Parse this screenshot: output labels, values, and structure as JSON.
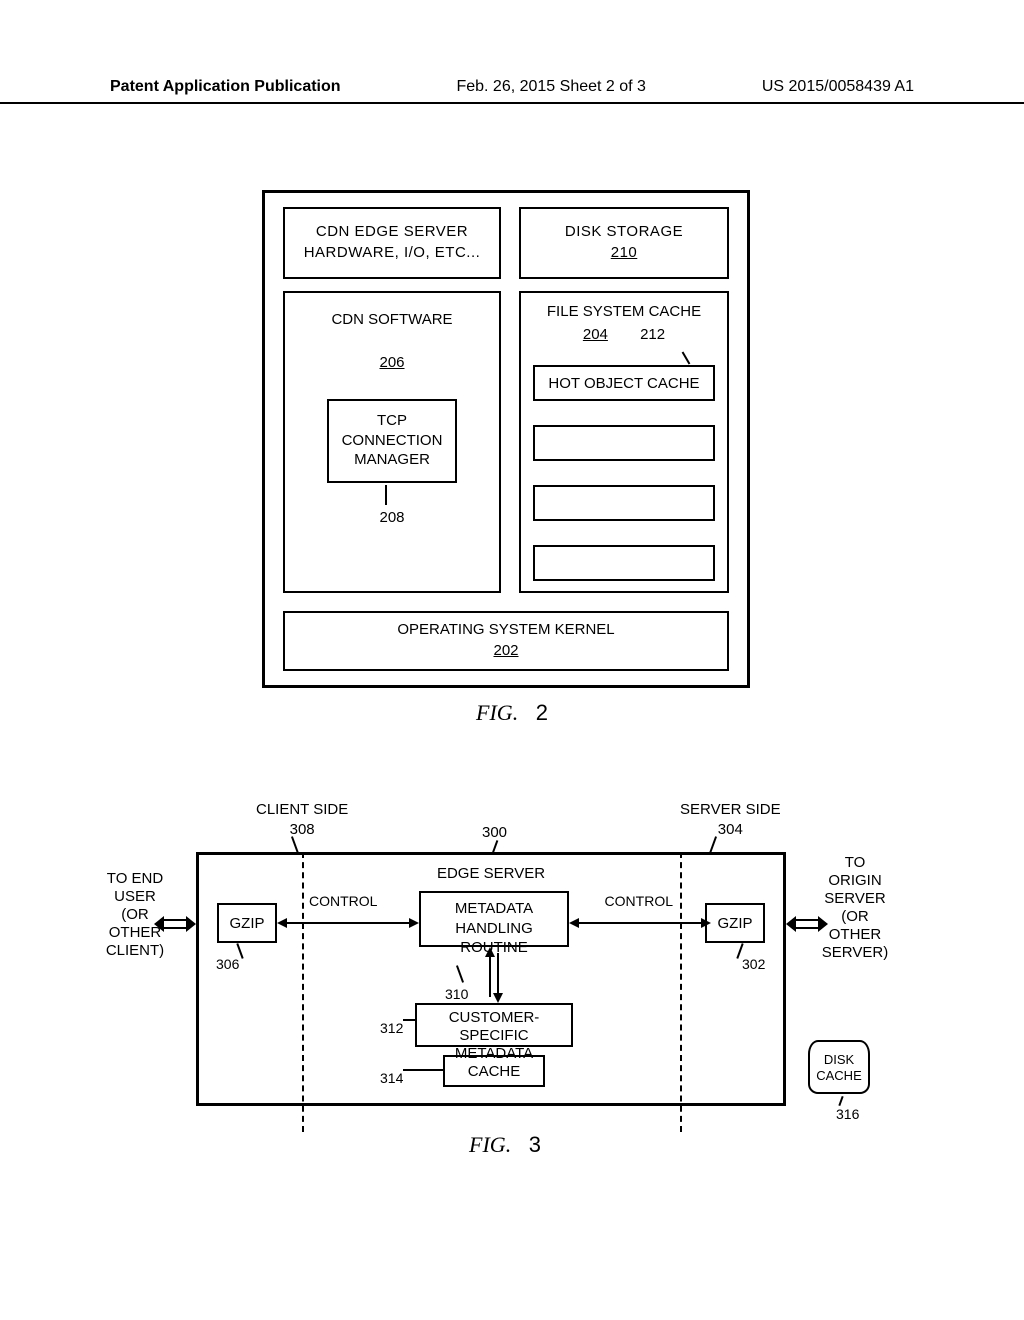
{
  "header": {
    "left": "Patent Application Publication",
    "center": "Feb. 26, 2015  Sheet 2 of 3",
    "right": "US 2015/0058439 A1"
  },
  "fig2": {
    "cdn_hw_line1": "CDN EDGE SERVER",
    "cdn_hw_line2": "HARDWARE, I/O, ETC...",
    "disk_storage": "DISK STORAGE",
    "disk_ref": "210",
    "cdn_software": "CDN SOFTWARE",
    "sw_ref": "206",
    "tcp_l1": "TCP",
    "tcp_l2": "CONNECTION",
    "tcp_l3": "MANAGER",
    "tcp_ref": "208",
    "fs_cache": "FILE SYSTEM CACHE",
    "fs_ref": "204",
    "hot_ref": "212",
    "hot_object_cache": "HOT OBJECT CACHE",
    "os_kernel": "OPERATING SYSTEM KERNEL",
    "os_ref": "202",
    "caption_prefix": "FIG.",
    "caption_num": "2"
  },
  "fig3": {
    "client_side": "CLIENT SIDE",
    "client_ref": "308",
    "server_side": "SERVER SIDE",
    "server_ref": "304",
    "ref300": "300",
    "edge_server": "EDGE SERVER",
    "gzip": "GZIP",
    "control": "CONTROL",
    "mhr_l1": "METADATA",
    "mhr_l2": "HANDLING ROUTINE",
    "csm_l1": "CUSTOMER-SPECIFIC",
    "csm_l2": "METADATA",
    "cache": "CACHE",
    "to_end_l1": "TO END",
    "to_end_l2": "USER",
    "to_end_l3": "(OR",
    "to_end_l4": "OTHER",
    "to_end_l5": "CLIENT)",
    "to_origin_l1": "TO",
    "to_origin_l2": "ORIGIN",
    "to_origin_l3": "SERVER",
    "to_origin_l4": "(OR",
    "to_origin_l5": "OTHER",
    "to_origin_l6": "SERVER)",
    "ref306": "306",
    "ref310": "310",
    "ref312": "312",
    "ref314": "314",
    "ref302": "302",
    "disk_l1": "DISK",
    "disk_l2": "CACHE",
    "ref316": "316",
    "caption_prefix": "FIG.",
    "caption_num": "3"
  }
}
